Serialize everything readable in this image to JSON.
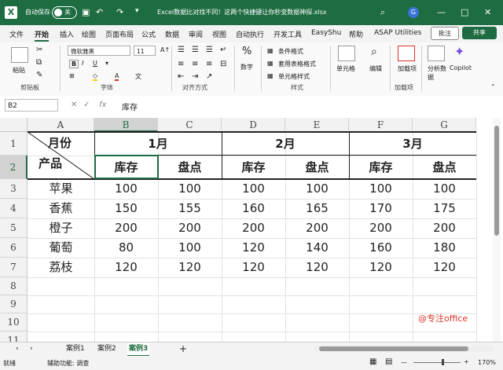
{
  "titlebar": {
    "autosave_label": "自动保存",
    "autosave_state": "关",
    "document_title": "Excel数据比对找不同！这两个快捷键让你秒变数据神探.xlsx",
    "avatar_initial": "G"
  },
  "menu": {
    "items": [
      "文件",
      "开始",
      "插入",
      "绘图",
      "页面布局",
      "公式",
      "数据",
      "审阅",
      "视图",
      "自动执行",
      "开发工具",
      "EasyShu",
      "帮助",
      "ASAP Utilities"
    ],
    "active": "开始",
    "comment_label": "批注",
    "share_label": "共享"
  },
  "ribbon": {
    "paste_label": "粘贴",
    "clipboard_group": "剪贴板",
    "font_name": "微软雅黑",
    "font_size": "11",
    "font_group": "字体",
    "align_group": "对齐方式",
    "number_label": "数字",
    "cond_format": "条件格式",
    "table_format": "套用表格格式",
    "cell_style": "单元格样式",
    "style_group": "样式",
    "cells_label": "单元格",
    "edit_label": "编辑",
    "addin_label": "加载项",
    "addin_group": "加载项",
    "analyze_label": "分析数据",
    "copilot_label": "Copilot"
  },
  "formula": {
    "name_box": "B2",
    "content": "库存"
  },
  "columns": [
    "A",
    "B",
    "C",
    "D",
    "E",
    "F",
    "G"
  ],
  "rows": [
    "1",
    "2",
    "3",
    "4",
    "5",
    "6",
    "7",
    "8",
    "9",
    "10",
    "11",
    "12"
  ],
  "sheet": {
    "corner_top": "月份",
    "corner_bottom": "产品",
    "months": [
      "1月",
      "2月",
      "3月"
    ],
    "subheaders": [
      "库存",
      "盘点",
      "库存",
      "盘点",
      "库存",
      "盘点"
    ],
    "products": [
      {
        "name": "苹果",
        "values": [
          "100",
          "100",
          "100",
          "100",
          "100",
          "100"
        ]
      },
      {
        "name": "香蕉",
        "values": [
          "150",
          "155",
          "160",
          "165",
          "170",
          "175"
        ]
      },
      {
        "name": "橙子",
        "values": [
          "200",
          "200",
          "200",
          "200",
          "200",
          "200"
        ]
      },
      {
        "name": "葡萄",
        "values": [
          "80",
          "100",
          "120",
          "140",
          "160",
          "180"
        ]
      },
      {
        "name": "荔枝",
        "values": [
          "120",
          "120",
          "120",
          "120",
          "120",
          "120"
        ]
      }
    ]
  },
  "watermark": "@专注office",
  "sheet_tabs": [
    "案例1",
    "案例2",
    "案例3"
  ],
  "active_sheet": "案例3",
  "status": {
    "ready": "就绪",
    "accessibility": "辅助功能: 调查",
    "zoom": "170%"
  }
}
